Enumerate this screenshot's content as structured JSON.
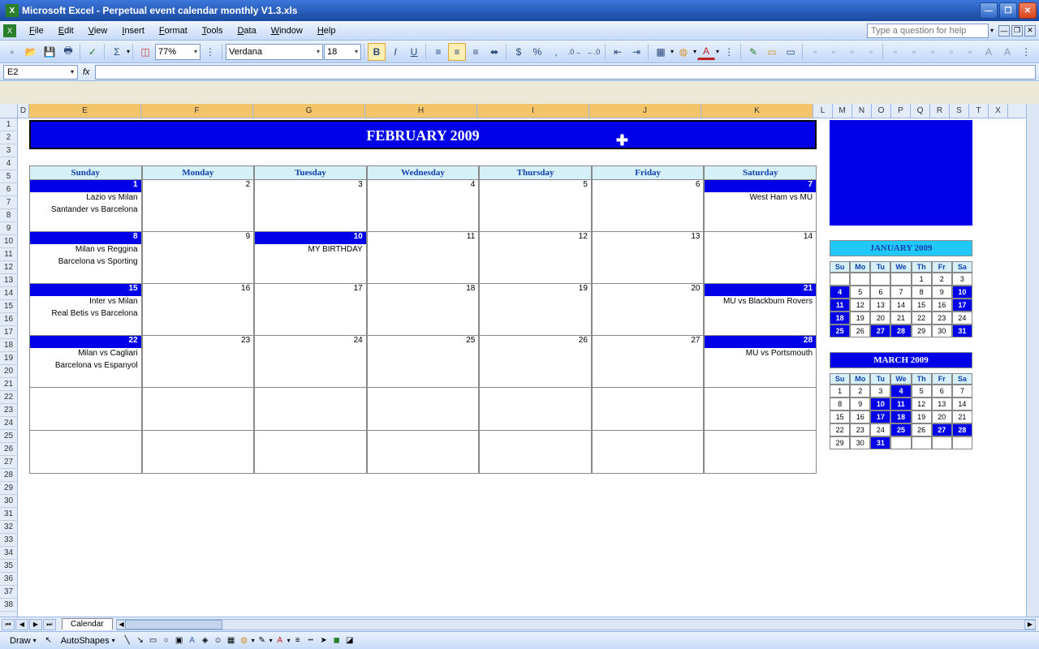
{
  "window": {
    "title": "Microsoft Excel - Perpetual event calendar monthly V1.3.xls"
  },
  "menus": [
    "File",
    "Edit",
    "View",
    "Insert",
    "Format",
    "Tools",
    "Data",
    "Window",
    "Help"
  ],
  "helpPlaceholder": "Type a question for help",
  "toolbar": {
    "zoom": "77%",
    "font": "Verdana",
    "size": "18"
  },
  "namebox": "E2",
  "columns_sel": [
    "E",
    "F",
    "G",
    "H",
    "I",
    "J",
    "K"
  ],
  "columns_rest": [
    "L",
    "M",
    "N",
    "O",
    "P",
    "Q",
    "R",
    "S",
    "T",
    "X"
  ],
  "rows": 38,
  "calendar": {
    "title": "FEBRUARY 2009",
    "days": [
      "Sunday",
      "Monday",
      "Tuesday",
      "Wednesday",
      "Thursday",
      "Friday",
      "Saturday"
    ],
    "weeks": [
      [
        {
          "num": "1",
          "hl": true,
          "events": [
            "Lazio vs Milan",
            "Santander vs Barcelona"
          ]
        },
        {
          "num": "2",
          "hl": false,
          "events": []
        },
        {
          "num": "3",
          "hl": false,
          "events": []
        },
        {
          "num": "4",
          "hl": false,
          "events": []
        },
        {
          "num": "5",
          "hl": false,
          "events": []
        },
        {
          "num": "6",
          "hl": false,
          "events": []
        },
        {
          "num": "7",
          "hl": true,
          "events": [
            "West Ham vs MU"
          ]
        }
      ],
      [
        {
          "num": "8",
          "hl": true,
          "events": [
            "Milan vs Reggina",
            "Barcelona vs Sporting"
          ]
        },
        {
          "num": "9",
          "hl": false,
          "events": []
        },
        {
          "num": "10",
          "hl": true,
          "events": [
            "MY BIRTHDAY"
          ]
        },
        {
          "num": "11",
          "hl": false,
          "events": []
        },
        {
          "num": "12",
          "hl": false,
          "events": []
        },
        {
          "num": "13",
          "hl": false,
          "events": []
        },
        {
          "num": "14",
          "hl": false,
          "events": []
        }
      ],
      [
        {
          "num": "15",
          "hl": true,
          "events": [
            "Inter vs Milan",
            "Real Betis vs Barcelona"
          ]
        },
        {
          "num": "16",
          "hl": false,
          "events": []
        },
        {
          "num": "17",
          "hl": false,
          "events": []
        },
        {
          "num": "18",
          "hl": false,
          "events": []
        },
        {
          "num": "19",
          "hl": false,
          "events": []
        },
        {
          "num": "20",
          "hl": false,
          "events": []
        },
        {
          "num": "21",
          "hl": true,
          "events": [
            "MU vs Blackburn Rovers"
          ]
        }
      ],
      [
        {
          "num": "22",
          "hl": true,
          "events": [
            "Milan vs Cagliari",
            "Barcelona vs Espanyol"
          ]
        },
        {
          "num": "23",
          "hl": false,
          "events": []
        },
        {
          "num": "24",
          "hl": false,
          "events": []
        },
        {
          "num": "25",
          "hl": false,
          "events": []
        },
        {
          "num": "26",
          "hl": false,
          "events": []
        },
        {
          "num": "27",
          "hl": false,
          "events": []
        },
        {
          "num": "28",
          "hl": true,
          "events": [
            "MU vs Portsmouth"
          ]
        }
      ],
      [
        {
          "num": "",
          "hl": false,
          "events": []
        },
        {
          "num": "",
          "hl": false,
          "events": []
        },
        {
          "num": "",
          "hl": false,
          "events": []
        },
        {
          "num": "",
          "hl": false,
          "events": []
        },
        {
          "num": "",
          "hl": false,
          "events": []
        },
        {
          "num": "",
          "hl": false,
          "events": []
        },
        {
          "num": "",
          "hl": false,
          "events": []
        }
      ],
      [
        {
          "num": "",
          "hl": false,
          "events": []
        },
        {
          "num": "",
          "hl": false,
          "events": []
        },
        {
          "num": "",
          "hl": false,
          "events": []
        },
        {
          "num": "",
          "hl": false,
          "events": []
        },
        {
          "num": "",
          "hl": false,
          "events": []
        },
        {
          "num": "",
          "hl": false,
          "events": []
        },
        {
          "num": "",
          "hl": false,
          "events": []
        }
      ]
    ]
  },
  "mini_days": [
    "Su",
    "Mo",
    "Tu",
    "We",
    "Th",
    "Fr",
    "Sa"
  ],
  "mini1": {
    "title": "JANUARY 2009",
    "rows": [
      [
        {
          "n": ""
        },
        {
          "n": ""
        },
        {
          "n": ""
        },
        {
          "n": ""
        },
        {
          "n": "1"
        },
        {
          "n": "2"
        },
        {
          "n": "3"
        }
      ],
      [
        {
          "n": "4",
          "hl": true
        },
        {
          "n": "5"
        },
        {
          "n": "6"
        },
        {
          "n": "7"
        },
        {
          "n": "8"
        },
        {
          "n": "9"
        },
        {
          "n": "10",
          "hl": true
        }
      ],
      [
        {
          "n": "11",
          "hl": true
        },
        {
          "n": "12"
        },
        {
          "n": "13"
        },
        {
          "n": "14"
        },
        {
          "n": "15"
        },
        {
          "n": "16"
        },
        {
          "n": "17",
          "hl": true
        }
      ],
      [
        {
          "n": "18",
          "hl": true
        },
        {
          "n": "19"
        },
        {
          "n": "20"
        },
        {
          "n": "21"
        },
        {
          "n": "22"
        },
        {
          "n": "23"
        },
        {
          "n": "24"
        }
      ],
      [
        {
          "n": "25",
          "hl": true
        },
        {
          "n": "26"
        },
        {
          "n": "27",
          "hl": true
        },
        {
          "n": "28",
          "hl": true
        },
        {
          "n": "29"
        },
        {
          "n": "30"
        },
        {
          "n": "31",
          "hl": true
        }
      ]
    ]
  },
  "mini2": {
    "title": "MARCH 2009",
    "rows": [
      [
        {
          "n": "1"
        },
        {
          "n": "2"
        },
        {
          "n": "3"
        },
        {
          "n": "4",
          "hl": true
        },
        {
          "n": "5"
        },
        {
          "n": "6"
        },
        {
          "n": "7"
        }
      ],
      [
        {
          "n": "8"
        },
        {
          "n": "9"
        },
        {
          "n": "10",
          "hl": true
        },
        {
          "n": "11",
          "hl": true
        },
        {
          "n": "12"
        },
        {
          "n": "13"
        },
        {
          "n": "14"
        }
      ],
      [
        {
          "n": "15"
        },
        {
          "n": "16"
        },
        {
          "n": "17",
          "hl": true
        },
        {
          "n": "18",
          "hl": true
        },
        {
          "n": "19"
        },
        {
          "n": "20"
        },
        {
          "n": "21"
        }
      ],
      [
        {
          "n": "22"
        },
        {
          "n": "23"
        },
        {
          "n": "24"
        },
        {
          "n": "25",
          "hl": true
        },
        {
          "n": "26"
        },
        {
          "n": "27",
          "hl": true
        },
        {
          "n": "28",
          "hl": true
        }
      ],
      [
        {
          "n": "29"
        },
        {
          "n": "30"
        },
        {
          "n": "31",
          "hl": true
        },
        {
          "n": ""
        },
        {
          "n": ""
        },
        {
          "n": ""
        },
        {
          "n": ""
        }
      ]
    ]
  },
  "tab": "Calendar",
  "status": {
    "draw": "Draw",
    "autoshapes": "AutoShapes"
  }
}
